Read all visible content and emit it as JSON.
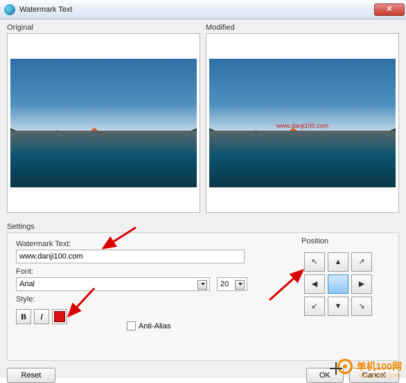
{
  "window": {
    "title": "Watermark Text"
  },
  "preview": {
    "original_label": "Original",
    "modified_label": "Modified",
    "watermark_render": "www.danji100.com"
  },
  "settings": {
    "group_label": "Settings",
    "watermark_text_label": "Watermark Text:",
    "watermark_text_value": "www.danji100.com",
    "font_label": "Font:",
    "font_name": "Arial",
    "font_size": "20",
    "style_label": "Style:",
    "bold_glyph": "B",
    "italic_glyph": "I",
    "color_hex": "#d11414",
    "antialias_label": "Anti-Alias",
    "antialias_checked": false
  },
  "position": {
    "group_label": "Position",
    "selected": "center",
    "arrows": {
      "tl": "↖",
      "t": "▲",
      "tr": "↗",
      "l": "◀",
      "c": " ",
      "r": "▶",
      "bl": "↙",
      "b": "▼",
      "br": "↘"
    }
  },
  "buttons": {
    "reset": "Reset",
    "ok": "OK",
    "cancel": "Cancel"
  },
  "branding": {
    "name": "单机100网",
    "url": "danji100.com"
  }
}
